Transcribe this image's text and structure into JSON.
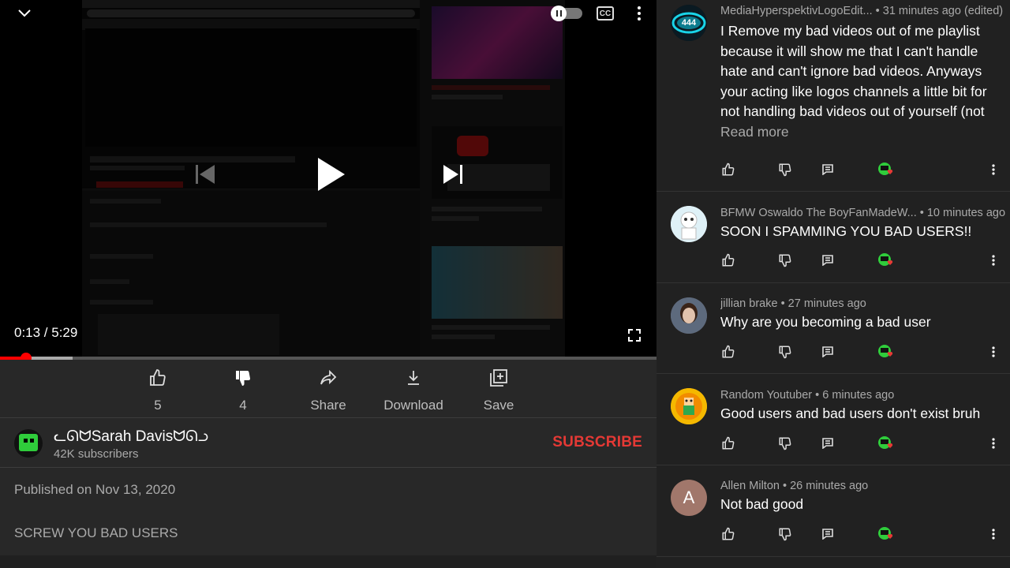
{
  "player": {
    "timecode": "0:13 / 5:29",
    "cc_label": "CC",
    "progress_played_fraction": 0.04,
    "progress_buffered_fraction": 0.11
  },
  "actions": [
    {
      "label": "5",
      "icon": "thumb-up-icon"
    },
    {
      "label": "4",
      "icon": "thumb-down-icon"
    },
    {
      "label": "Share",
      "icon": "share-icon"
    },
    {
      "label": "Download",
      "icon": "download-icon"
    },
    {
      "label": "Save",
      "icon": "save-playlist-icon"
    }
  ],
  "channel": {
    "name": "ᓚᘏᗢSarah Davisᗢᘏᓗ",
    "subscribers": "42K subscribers",
    "subscribe_label": "SUBSCRIBE"
  },
  "published": "Published on Nov 13, 2020",
  "description": "SCREW YOU BAD USERS",
  "comments": [
    {
      "meta": "MediaHyperspektivLogoEdit... • 31 minutes ago (edited)",
      "avatar_text": "444",
      "text": "I Remove my bad videos out of me playlist because it will show me that I can't handle hate and can't ignore bad videos. Anyways your acting like logos channels a little bit for not handling bad videos out of yourself (not",
      "read_more": "Read more"
    },
    {
      "meta": "BFMW Oswaldo The BoyFanMadeW... • 10 minutes ago",
      "text": "SOON I SPAMMING YOU BAD USERS!!"
    },
    {
      "meta": "jillian brake • 27 minutes ago",
      "text": "Why are you becoming a bad user"
    },
    {
      "meta": "Random Youtuber • 6 minutes ago",
      "text": "Good users and bad users don't exist bruh"
    },
    {
      "meta": "Allen Milton • 26 minutes ago",
      "avatar_text": "A",
      "text": "Not bad good"
    }
  ],
  "colors": {
    "accent_red": "#e53935",
    "background": "#282828",
    "comments_bg": "#212121",
    "heart": "#e53935"
  }
}
